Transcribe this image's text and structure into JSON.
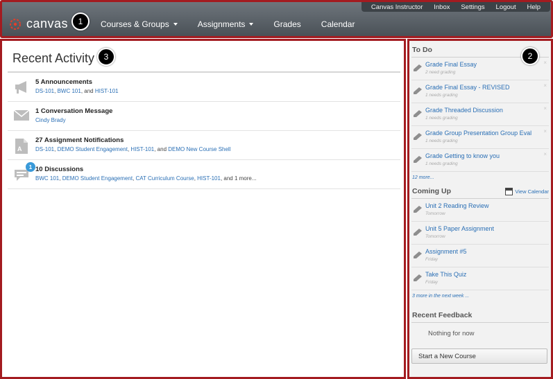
{
  "header": {
    "logo_text": "canvas",
    "utility_links": [
      "Canvas Instructor",
      "Inbox",
      "Settings",
      "Logout",
      "Help"
    ],
    "nav": [
      {
        "label": "Courses & Groups",
        "dropdown": true
      },
      {
        "label": "Assignments",
        "dropdown": true
      },
      {
        "label": "Grades",
        "dropdown": false
      },
      {
        "label": "Calendar",
        "dropdown": false
      }
    ]
  },
  "callouts": [
    "1",
    "2",
    "3"
  ],
  "main": {
    "title": "Recent Activity",
    "activities": [
      {
        "icon": "megaphone-icon",
        "title": "5 Announcements",
        "parts": [
          {
            "link": "DS-101"
          },
          {
            "text": ", "
          },
          {
            "link": "BWC 101"
          },
          {
            "text": ", and "
          },
          {
            "link": "HIST-101"
          }
        ]
      },
      {
        "icon": "envelope-icon",
        "title": "1 Conversation Message",
        "parts": [
          {
            "link": "Cindy Brady"
          }
        ]
      },
      {
        "icon": "assignment-icon",
        "title": "27 Assignment Notifications",
        "parts": [
          {
            "link": "DS-101"
          },
          {
            "text": ", "
          },
          {
            "link": "DEMO Student Engagement"
          },
          {
            "text": ", "
          },
          {
            "link": "HIST-101"
          },
          {
            "text": ", and "
          },
          {
            "link": "DEMO New Course Shell"
          }
        ]
      },
      {
        "icon": "discussion-icon",
        "badge": "1",
        "title": "10 Discussions",
        "parts": [
          {
            "link": "BWC 101"
          },
          {
            "text": ", "
          },
          {
            "link": "DEMO Student Engagement"
          },
          {
            "text": ", "
          },
          {
            "link": "CAT Curriculum Course"
          },
          {
            "text": ", "
          },
          {
            "link": "HIST-101"
          },
          {
            "text": ", and 1 more..."
          }
        ]
      }
    ]
  },
  "sidebar": {
    "todo_heading": "To Do",
    "todo": [
      {
        "title": "Grade Final Essay",
        "sub": "2 need grading"
      },
      {
        "title": "Grade Final Essay - REVISED",
        "sub": "1 needs grading"
      },
      {
        "title": "Grade Threaded Discussion",
        "sub": "1 needs grading"
      },
      {
        "title": "Grade Group Presentation Group Eval",
        "sub": "1 needs grading"
      },
      {
        "title": "Grade Getting to know you",
        "sub": "1 needs grading"
      }
    ],
    "todo_more": "12 more...",
    "coming_heading": "Coming Up",
    "view_calendar": "View Calendar",
    "coming": [
      {
        "title": "Unit 2 Reading Review",
        "sub": "Tomorrow"
      },
      {
        "title": "Unit 5 Paper Assignment",
        "sub": "Tomorrow"
      },
      {
        "title": "Assignment #5",
        "sub": "Friday"
      },
      {
        "title": "Take This Quiz",
        "sub": "Friday"
      }
    ],
    "coming_more": "3 more in the next week ...",
    "feedback_heading": "Recent Feedback",
    "feedback_empty": "Nothing for now",
    "new_course_button": "Start a New Course"
  },
  "colors": {
    "annotation_border": "#a31b20",
    "link": "#2a6fb5",
    "header_top": "#6e757c",
    "header_bottom": "#4a5157"
  }
}
